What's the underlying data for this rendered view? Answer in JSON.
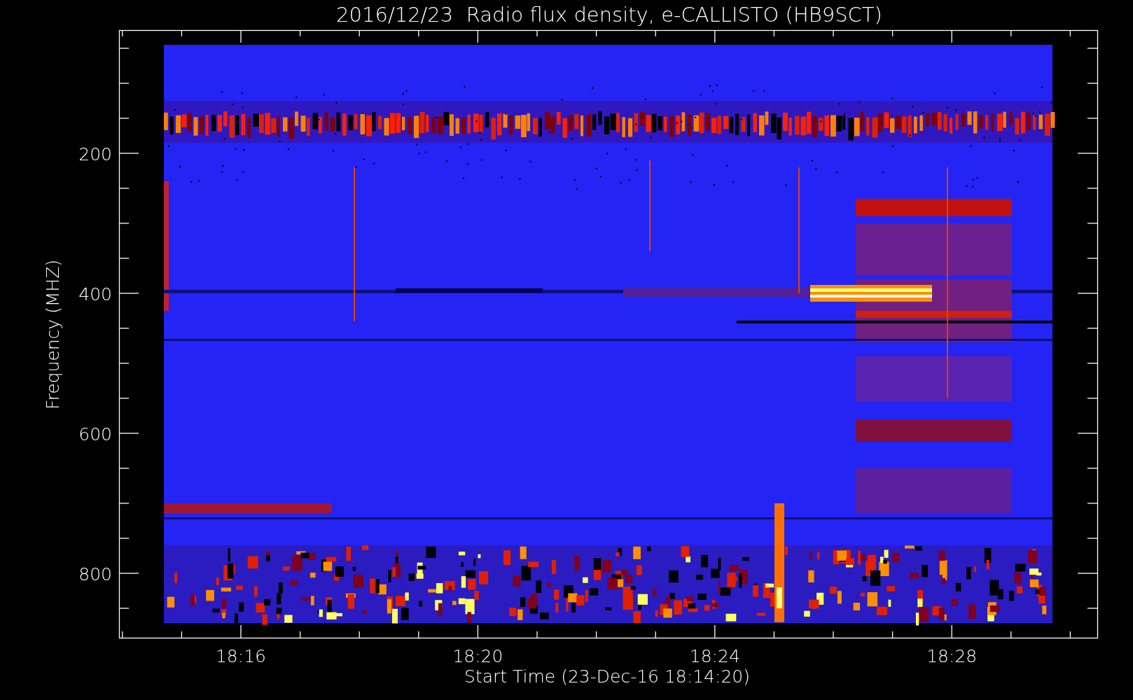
{
  "title": "2016/12/23  Radio flux density, e-CALLISTO (HB9SCT)",
  "y_axis": {
    "label": "Frequency (MHZ)",
    "tick_labels": [
      "200",
      "400",
      "600",
      "800"
    ]
  },
  "x_axis": {
    "label": "Start Time (23-Dec-16 18:14:20)",
    "tick_labels": [
      "18:16",
      "18:20",
      "18:24",
      "18:28"
    ]
  }
}
